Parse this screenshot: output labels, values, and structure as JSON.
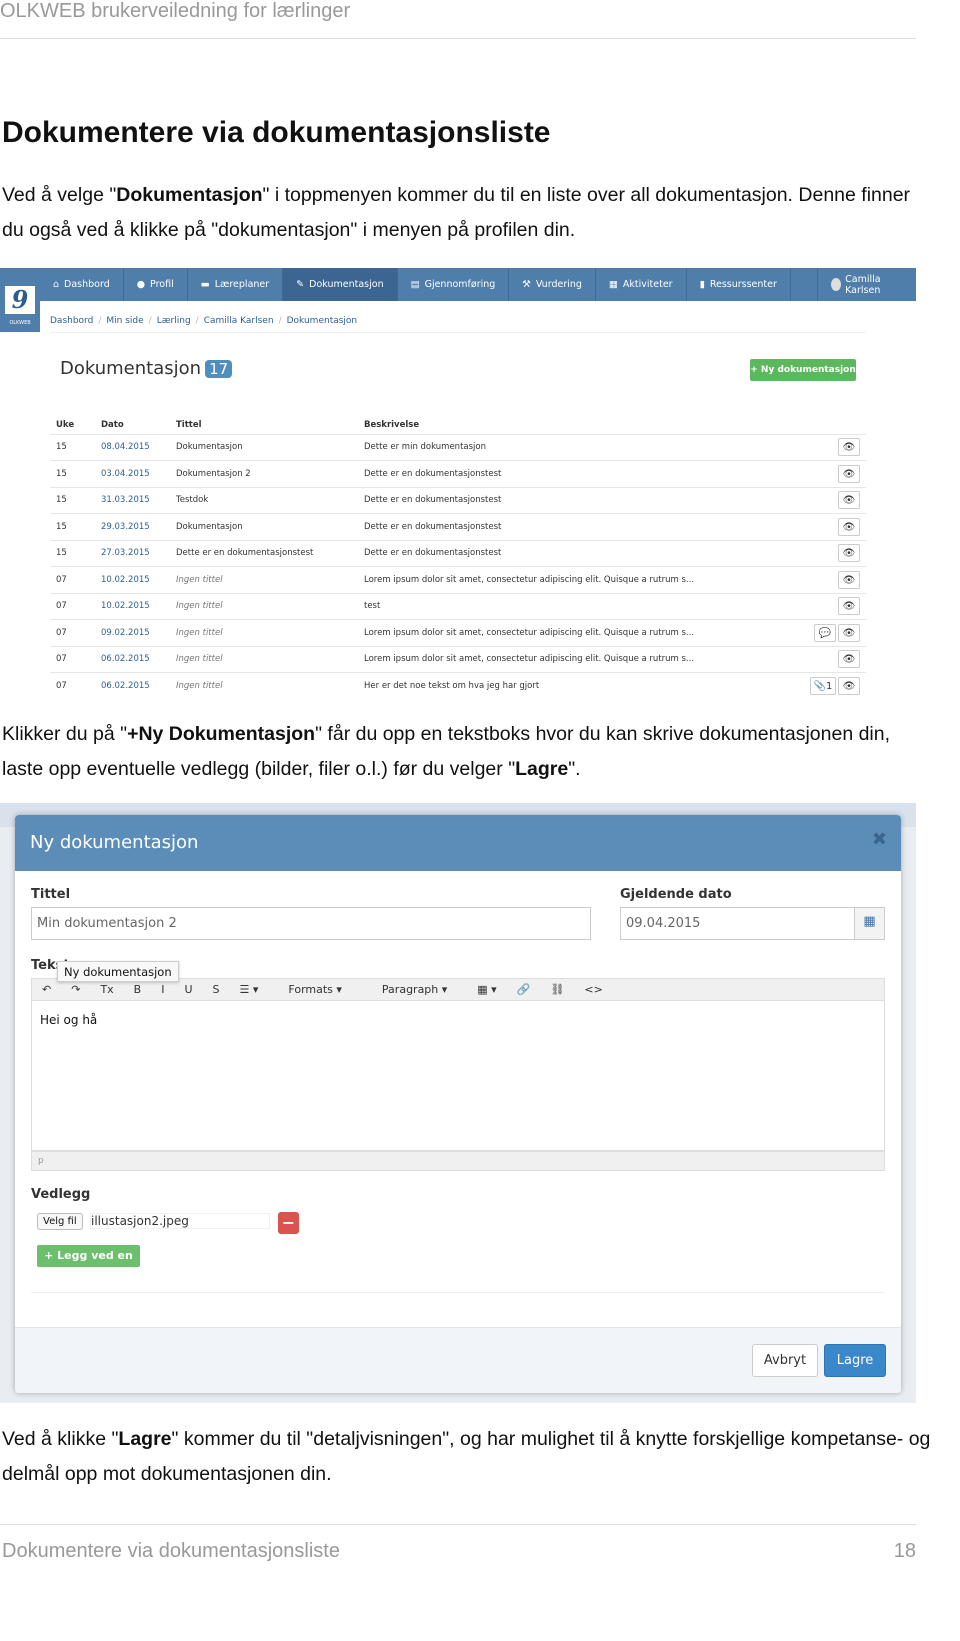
{
  "header": "OLKWEB brukerveiledning for lærlinger",
  "title": "Dokumentere via dokumentasjonsliste",
  "para1": {
    "a": "Ved å velge \"",
    "b": "Dokumentasjon",
    "c": "\" i toppmenyen kommer du til en liste over all dokumentasjon. Denne finner du også ved å klikke på \"dokumentasjon\" i menyen på profilen din."
  },
  "para2": {
    "a": "Klikker du på \"",
    "b": "+Ny Dokumentasjon",
    "c": "\" får du opp en tekstboks hvor du kan skrive dokumentasjonen din, laste opp eventuelle vedlegg (bilder, filer o.l.) før du velger \"",
    "d": "Lagre",
    "e": "\"."
  },
  "para3": {
    "a": "Ved å klikke \"",
    "b": "Lagre",
    "c": "\" kommer du til \"detaljvisningen\", og har mulighet til å knytte forskjellige kompetanse- og delmål opp mot dokumentasjonen din."
  },
  "footer": {
    "title": "Dokumentere via dokumentasjonsliste",
    "page": "18"
  },
  "app": {
    "logo_text": "OLKWEB",
    "nav": [
      {
        "icon": "home-icon",
        "glyph": "⌂",
        "label": "Dashbord"
      },
      {
        "icon": "user-icon",
        "glyph": "●",
        "label": "Profil"
      },
      {
        "icon": "folder-icon",
        "glyph": "▬",
        "label": "Læreplaner"
      },
      {
        "icon": "pencil-icon",
        "glyph": "✎",
        "label": "Dokumentasjon",
        "active": true
      },
      {
        "icon": "list-icon",
        "glyph": "▤",
        "label": "Gjennomføring"
      },
      {
        "icon": "gavel-icon",
        "glyph": "⚒",
        "label": "Vurdering"
      },
      {
        "icon": "calendar-icon",
        "glyph": "▦",
        "label": "Aktiviteter"
      },
      {
        "icon": "file-icon",
        "glyph": "▮",
        "label": "Ressurssenter"
      }
    ],
    "user": "Camilla Karlsen",
    "breadcrumb": [
      "Dashbord",
      "Min side",
      "Lærling",
      "Camilla Karlsen",
      "Dokumentasjon"
    ],
    "page_title": "Dokumentasjon",
    "count": "17",
    "new_button": "+ Ny dokumentasjon",
    "columns": [
      "Uke",
      "Dato",
      "Tittel",
      "Beskrivelse"
    ],
    "rows": [
      [
        "15",
        "08.04.2015",
        "Dokumentasjon",
        "Dette er min dokumentasjon",
        ""
      ],
      [
        "15",
        "03.04.2015",
        "Dokumentasjon 2",
        "Dette er en dokumentasjonstest",
        ""
      ],
      [
        "15",
        "31.03.2015",
        "Testdok",
        "Dette er en dokumentasjonstest",
        ""
      ],
      [
        "15",
        "29.03.2015",
        "Dokumentasjon",
        "Dette er en dokumentasjonstest",
        ""
      ],
      [
        "15",
        "27.03.2015",
        "Dette er en dokumentasjonstest",
        "Dette er en dokumentasjonstest",
        ""
      ],
      [
        "07",
        "10.02.2015",
        "Ingen tittel",
        "Lorem ipsum dolor sit amet, consectetur adipiscing elit. Quisque a rutrum s...",
        ""
      ],
      [
        "07",
        "10.02.2015",
        "Ingen tittel",
        "test",
        ""
      ],
      [
        "07",
        "09.02.2015",
        "Ingen tittel",
        "Lorem ipsum dolor sit amet, consectetur adipiscing elit. Quisque a rutrum s...",
        "comment"
      ],
      [
        "07",
        "06.02.2015",
        "Ingen tittel",
        "Lorem ipsum dolor sit amet, consectetur adipiscing elit. Quisque a rutrum s...",
        ""
      ],
      [
        "07",
        "06.02.2015",
        "Ingen tittel",
        "Her er det noe tekst om hva jeg har gjort",
        "attach"
      ]
    ],
    "attach_count": "1"
  },
  "modal": {
    "title": "Ny dokumentasjon",
    "title_label": "Tittel",
    "title_value": "Min dokumentasjon 2",
    "date_label": "Gjeldende dato",
    "date_value": "09.04.2015",
    "text_label": "Tekst",
    "tooltip": "Ny dokumentasjon",
    "toolbar": [
      "↶",
      "↷",
      "Tx",
      "B",
      "I",
      "U",
      "S",
      "☰ ▾",
      "Formats ▾",
      "Paragraph ▾",
      "▦ ▾",
      "🔗",
      "⛓",
      "<>"
    ],
    "editor_text": "Hei og hå",
    "status_path": "p",
    "attach_label": "Vedlegg",
    "choose_file": "Velg fil",
    "file_name": "illustasjon2.jpeg",
    "add_file": "+ Legg ved en fil",
    "cancel": "Avbryt",
    "save": "Lagre"
  },
  "colors": {
    "nav": "#4f7eab",
    "success": "#5cb85c",
    "danger": "#d9534f",
    "primary": "#3a87c9",
    "modal_header": "#5b8db8"
  }
}
